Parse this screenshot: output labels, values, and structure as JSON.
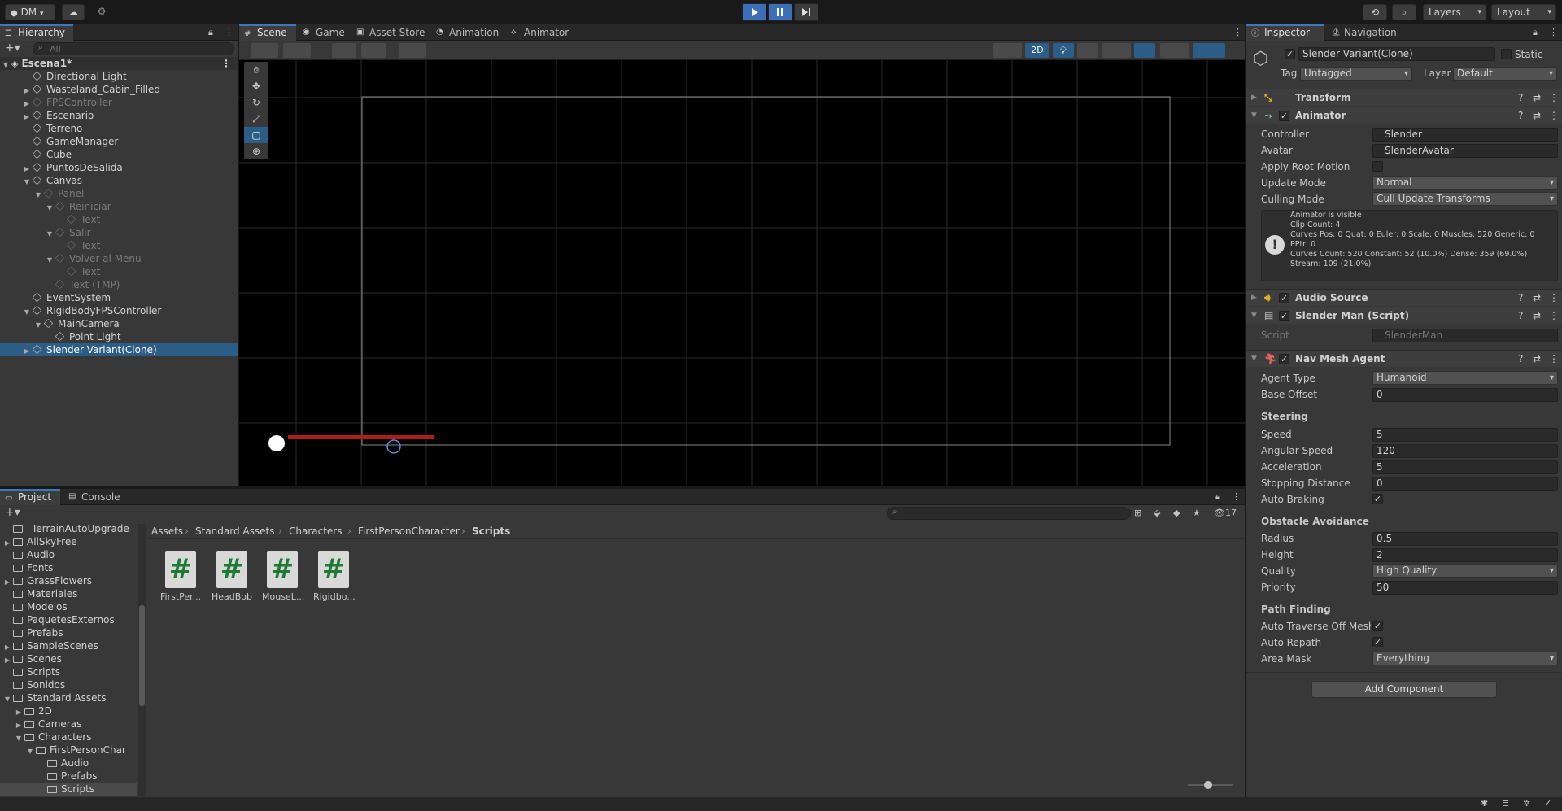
{
  "toolbar": {
    "account": "DM",
    "layers": "Layers",
    "layout": "Layout"
  },
  "hierarchy": {
    "tab": "Hierarchy",
    "search_placeholder": "All",
    "scene": "Escena1*",
    "items": [
      {
        "label": "Directional Light",
        "depth": 1,
        "arrow": "",
        "dim": false
      },
      {
        "label": "Wasteland_Cabin_Filled",
        "depth": 1,
        "arrow": "▶",
        "dim": false
      },
      {
        "label": "FPSController",
        "depth": 1,
        "arrow": "▶",
        "dim": true
      },
      {
        "label": "Escenario",
        "depth": 1,
        "arrow": "▶",
        "dim": false
      },
      {
        "label": "Terreno",
        "depth": 1,
        "arrow": "",
        "dim": false
      },
      {
        "label": "GameManager",
        "depth": 1,
        "arrow": "",
        "dim": false
      },
      {
        "label": "Cube",
        "depth": 1,
        "arrow": "",
        "dim": false
      },
      {
        "label": "PuntosDeSalida",
        "depth": 1,
        "arrow": "▶",
        "dim": false
      },
      {
        "label": "Canvas",
        "depth": 1,
        "arrow": "▼",
        "dim": false
      },
      {
        "label": "Panel",
        "depth": 2,
        "arrow": "▼",
        "dim": true
      },
      {
        "label": "Reiniciar",
        "depth": 3,
        "arrow": "▼",
        "dim": true
      },
      {
        "label": "Text",
        "depth": 4,
        "arrow": "",
        "dim": true
      },
      {
        "label": "Salir",
        "depth": 3,
        "arrow": "▼",
        "dim": true
      },
      {
        "label": "Text",
        "depth": 4,
        "arrow": "",
        "dim": true
      },
      {
        "label": "Volver al Menu",
        "depth": 3,
        "arrow": "▼",
        "dim": true
      },
      {
        "label": "Text",
        "depth": 4,
        "arrow": "",
        "dim": true
      },
      {
        "label": "Text (TMP)",
        "depth": 3,
        "arrow": "",
        "dim": true
      },
      {
        "label": "EventSystem",
        "depth": 1,
        "arrow": "",
        "dim": false
      },
      {
        "label": "RigidBodyFPSController",
        "depth": 1,
        "arrow": "▼",
        "dim": false
      },
      {
        "label": "MainCamera",
        "depth": 2,
        "arrow": "▼",
        "dim": false
      },
      {
        "label": "Point Light",
        "depth": 3,
        "arrow": "",
        "dim": false
      },
      {
        "label": "Slender Variant(Clone)",
        "depth": 1,
        "arrow": "▶",
        "dim": false,
        "selected": true
      }
    ]
  },
  "scene_tabs": [
    "Scene",
    "Game",
    "Asset Store",
    "Animation",
    "Animator"
  ],
  "scene_toolbar": {
    "mode_2d": "2D"
  },
  "inspector": {
    "tabs": [
      "Inspector",
      "Navigation"
    ],
    "object_name": "Slender Variant(Clone)",
    "static_label": "Static",
    "tag_label": "Tag",
    "tag_value": "Untagged",
    "layer_label": "Layer",
    "layer_value": "Default",
    "transform": "Transform",
    "animator": {
      "title": "Animator",
      "controller_label": "Controller",
      "controller_value": "Slender",
      "avatar_label": "Avatar",
      "avatar_value": "SlenderAvatar",
      "apply_root_label": "Apply Root Motion",
      "update_mode_label": "Update Mode",
      "update_mode_value": "Normal",
      "culling_label": "Culling Mode",
      "culling_value": "Cull Update Transforms",
      "info": [
        "Animator is visible",
        "Clip Count: 4",
        "Curves Pos: 0 Quat: 0 Euler: 0 Scale: 0 Muscles: 520 Generic: 0",
        "PPtr: 0",
        "Curves Count: 520 Constant: 52 (10.0%) Dense: 359 (69.0%)",
        "Stream: 109 (21.0%)"
      ]
    },
    "audio_source": "Audio Source",
    "slender_script": {
      "title": "Slender Man (Script)",
      "script_label": "Script",
      "script_value": "SlenderMan"
    },
    "nav_mesh": {
      "title": "Nav Mesh Agent",
      "agent_type_label": "Agent Type",
      "agent_type_value": "Humanoid",
      "base_offset_label": "Base Offset",
      "base_offset_value": "0",
      "steering": "Steering",
      "speed_label": "Speed",
      "speed_value": "5",
      "angular_label": "Angular Speed",
      "angular_value": "120",
      "accel_label": "Acceleration",
      "accel_value": "5",
      "stopping_label": "Stopping Distance",
      "stopping_value": "0",
      "braking_label": "Auto Braking",
      "obstacle": "Obstacle Avoidance",
      "radius_label": "Radius",
      "radius_value": "0.5",
      "height_label": "Height",
      "height_value": "2",
      "quality_label": "Quality",
      "quality_value": "High Quality",
      "priority_label": "Priority",
      "priority_value": "50",
      "path": "Path Finding",
      "traverse_label": "Auto Traverse Off Mesh Link",
      "repath_label": "Auto Repath",
      "area_label": "Area Mask",
      "area_value": "Everything"
    },
    "add_component": "Add Component"
  },
  "project": {
    "tabs": [
      "Project",
      "Console"
    ],
    "hidden_count": "17",
    "tree": [
      {
        "label": "_TerrainAutoUpgrade",
        "depth": 0,
        "arrow": ""
      },
      {
        "label": "AllSkyFree",
        "depth": 0,
        "arrow": "▶"
      },
      {
        "label": "Audio",
        "depth": 0,
        "arrow": ""
      },
      {
        "label": "Fonts",
        "depth": 0,
        "arrow": ""
      },
      {
        "label": "GrassFlowers",
        "depth": 0,
        "arrow": "▶"
      },
      {
        "label": "Materiales",
        "depth": 0,
        "arrow": ""
      },
      {
        "label": "Modelos",
        "depth": 0,
        "arrow": ""
      },
      {
        "label": "PaquetesExternos",
        "depth": 0,
        "arrow": ""
      },
      {
        "label": "Prefabs",
        "depth": 0,
        "arrow": ""
      },
      {
        "label": "SampleScenes",
        "depth": 0,
        "arrow": "▶"
      },
      {
        "label": "Scenes",
        "depth": 0,
        "arrow": "▶"
      },
      {
        "label": "Scripts",
        "depth": 0,
        "arrow": ""
      },
      {
        "label": "Sonidos",
        "depth": 0,
        "arrow": ""
      },
      {
        "label": "Standard Assets",
        "depth": 0,
        "arrow": "▼"
      },
      {
        "label": "2D",
        "depth": 1,
        "arrow": "▶"
      },
      {
        "label": "Cameras",
        "depth": 1,
        "arrow": "▶"
      },
      {
        "label": "Characters",
        "depth": 1,
        "arrow": "▼"
      },
      {
        "label": "FirstPersonChar",
        "depth": 2,
        "arrow": "▼"
      },
      {
        "label": "Audio",
        "depth": 3,
        "arrow": ""
      },
      {
        "label": "Prefabs",
        "depth": 3,
        "arrow": ""
      },
      {
        "label": "Scripts",
        "depth": 3,
        "arrow": "",
        "selected": true
      }
    ],
    "breadcrumb": [
      "Assets",
      "Standard Assets",
      "Characters",
      "FirstPersonCharacter",
      "Scripts"
    ],
    "assets": [
      "FirstPer...",
      "HeadBob",
      "MouseL...",
      "Rigidbo..."
    ]
  }
}
